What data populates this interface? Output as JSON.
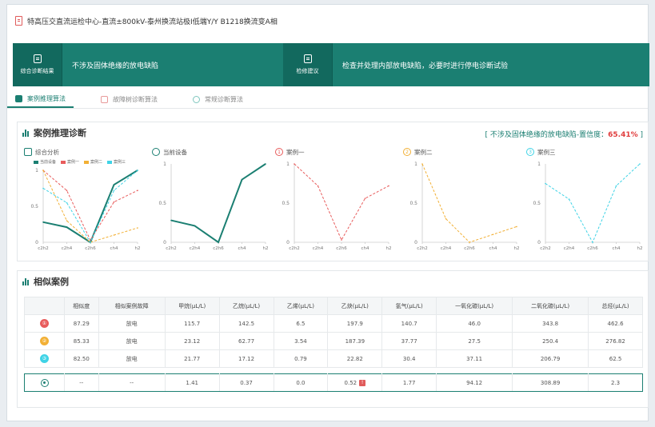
{
  "window_title": "特高压交直流运检中心-直流±800kV-泰州换流站极Ⅰ低端Y/Y B1218换流变A相",
  "banner": {
    "result_tag": "综合诊断结果",
    "result_text": "不涉及固体绝缘的放电缺陷",
    "advice_tag": "检修建议",
    "advice_text": "检查并处理内部放电缺陷，必要时进行停电诊断试验"
  },
  "tabs": [
    "案例推理算法",
    "故障树诊断算法",
    "常规诊断算法"
  ],
  "reasoning": {
    "title": "案例推理诊断",
    "conclusion_prefix": "[ 不涉及固体绝缘的放电缺陷-置信度：",
    "conclusion_pct": "65.41%",
    "conclusion_suffix": " ]"
  },
  "charts": {
    "titles": [
      "综合分析",
      "当前设备",
      "案例一",
      "案例二",
      "案例三"
    ],
    "legend": [
      "当前设备",
      "案例一",
      "案例二",
      "案例三"
    ],
    "colors": {
      "current": "#1b7f72",
      "case1": "#e85c5c",
      "case2": "#f2b035",
      "case3": "#3fd3e6"
    }
  },
  "chart_data": {
    "type": "line",
    "x": [
      "c2h2",
      "c2h4",
      "c2h6",
      "ch4",
      "h2"
    ],
    "ylim": [
      0,
      1
    ],
    "yticks": [
      "0",
      "0.5",
      "1"
    ],
    "series": [
      {
        "name": "当前设备",
        "values": [
          0.28,
          0.21,
          0.0,
          0.8,
          1.0
        ]
      },
      {
        "name": "案例一",
        "values": [
          1.0,
          0.72,
          0.03,
          0.56,
          0.72
        ]
      },
      {
        "name": "案例二",
        "values": [
          1.0,
          0.3,
          0.0,
          0.1,
          0.2
        ]
      },
      {
        "name": "案例三",
        "values": [
          0.75,
          0.55,
          0.0,
          0.72,
          1.0
        ]
      }
    ]
  },
  "similar": {
    "title": "相似案例",
    "headers": [
      "",
      "相似度",
      "相似案例故障",
      "甲烷(μL/L)",
      "乙烷(μL/L)",
      "乙烯(μL/L)",
      "乙炔(μL/L)",
      "氢气(μL/L)",
      "一氧化碳(μL/L)",
      "二氧化碳(μL/L)",
      "总烃(μL/L)"
    ],
    "rows": [
      {
        "rank": "①",
        "cells": [
          "87.29",
          "放电",
          "115.7",
          "142.5",
          "6.5",
          "197.9",
          "140.7",
          "46.0",
          "343.8",
          "462.6"
        ]
      },
      {
        "rank": "②",
        "cells": [
          "85.33",
          "放电",
          "23.12",
          "62.77",
          "3.54",
          "187.39",
          "37.77",
          "27.5",
          "250.4",
          "276.82"
        ]
      },
      {
        "rank": "③",
        "cells": [
          "82.50",
          "放电",
          "21.77",
          "17.12",
          "0.79",
          "22.82",
          "30.4",
          "37.11",
          "206.79",
          "62.5"
        ]
      }
    ],
    "current": [
      "--",
      "--",
      "1.41",
      "0.37",
      "0.0",
      "0.52",
      "1.77",
      "94.12",
      "308.89",
      "2.3"
    ]
  }
}
